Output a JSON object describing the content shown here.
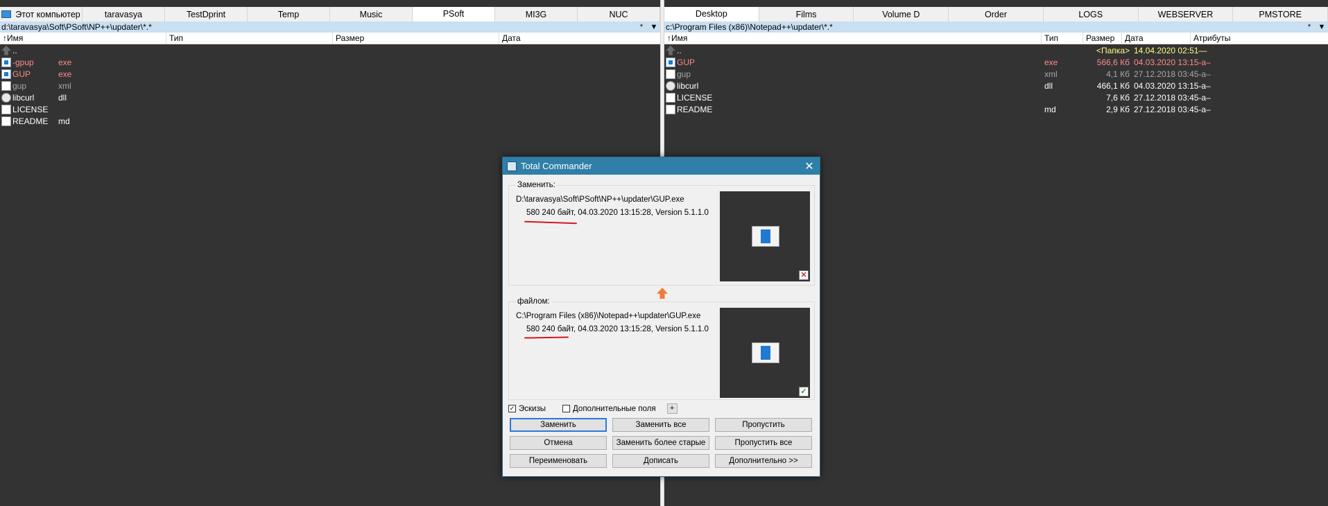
{
  "left_panel": {
    "tabs": [
      {
        "label": "Этот компьютер",
        "icon": "computer-icon"
      },
      {
        "label": "taravasya"
      },
      {
        "label": "TestDprint"
      },
      {
        "label": "Temp"
      },
      {
        "label": "Music"
      },
      {
        "label": "PSoft",
        "active": true
      },
      {
        "label": "MI3G"
      },
      {
        "label": "NUC"
      }
    ],
    "path": "d:\\taravasya\\Soft\\PSoft\\NP++\\updater\\*.*",
    "path_star": "*",
    "path_dropdown": "▼",
    "headers": {
      "name": "↑Имя",
      "type": "Тип",
      "size": "Размер",
      "date": "Дата"
    },
    "files": [
      {
        "name": "..",
        "ext": "",
        "icon": "up-icon",
        "color": "white"
      },
      {
        "name": "-gpup",
        "ext": "exe",
        "icon": "exe-icon",
        "color": "red"
      },
      {
        "name": "GUP",
        "ext": "exe",
        "icon": "exe-icon",
        "color": "red"
      },
      {
        "name": "gup",
        "ext": "xml",
        "icon": "xml-icon",
        "color": "gray"
      },
      {
        "name": "libcurl",
        "ext": "dll",
        "icon": "dll-icon",
        "color": "white"
      },
      {
        "name": "LICENSE",
        "ext": "",
        "icon": "file-icon",
        "color": "white"
      },
      {
        "name": "README",
        "ext": "md",
        "icon": "file-icon",
        "color": "white"
      }
    ]
  },
  "right_panel": {
    "tabs": [
      {
        "label": "Desktop",
        "active": true
      },
      {
        "label": "Films"
      },
      {
        "label": "Volume D"
      },
      {
        "label": "Order"
      },
      {
        "label": "LOGS"
      },
      {
        "label": "WEBSERVER"
      },
      {
        "label": "PMSTORE"
      }
    ],
    "path": "c:\\Program Files (x86)\\Notepad++\\updater\\*.*",
    "path_star": "*",
    "path_dropdown": "▼",
    "headers": {
      "name": "↑Имя",
      "type": "Тип",
      "size": "Размер",
      "date": "Дата",
      "attrs": "Атрибуты"
    },
    "files": [
      {
        "name": "..",
        "ext": "",
        "size": "<Папка>",
        "date": "14.04.2020 02:51—",
        "icon": "up-icon",
        "color": "yellow"
      },
      {
        "name": "GUP",
        "ext": "exe",
        "size": "566,6 Кб",
        "date": "04.03.2020 13:15-a–",
        "icon": "exe-icon",
        "color": "red"
      },
      {
        "name": "gup",
        "ext": "xml",
        "size": "4,1 Кб",
        "date": "27.12.2018 03:45-a–",
        "icon": "xml-icon",
        "color": "gray"
      },
      {
        "name": "libcurl",
        "ext": "dll",
        "size": "466,1 Кб",
        "date": "04.03.2020 13:15-a–",
        "icon": "dll-icon",
        "color": "white"
      },
      {
        "name": "LICENSE",
        "ext": "",
        "size": "7,6 Кб",
        "date": "27.12.2018 03:45-a–",
        "icon": "file-icon",
        "color": "white"
      },
      {
        "name": "README",
        "ext": "md",
        "size": "2,9 Кб",
        "date": "27.12.2018 03:45-a–",
        "icon": "file-icon",
        "color": "white"
      }
    ]
  },
  "dialog": {
    "title": "Total Commander",
    "close": "✕",
    "replace_label": "Заменить:",
    "replace_path": "D:\\taravasya\\Soft\\PSoft\\NP++\\updater\\GUP.exe",
    "replace_info": "580 240 байт, 04.03.2020 13:15:28, Version 5.1.1.0",
    "with_label": "файлом:",
    "with_path": "C:\\Program Files (x86)\\Notepad++\\updater\\GUP.exe",
    "with_info": "580 240 байт, 04.03.2020 13:15:28, Version 5.1.1.0",
    "thumbnails_label": "Эскизы",
    "thumbnails_checked": true,
    "extra_fields_label": "Дополнительные поля",
    "extra_fields_checked": false,
    "plus": "+",
    "buttons": {
      "replace": "Заменить",
      "replace_all": "Заменить все",
      "skip": "Пропустить",
      "cancel": "Отмена",
      "replace_older": "Заменить более старые",
      "skip_all": "Пропустить все",
      "rename": "Переименовать",
      "append": "Дописать",
      "more": "Дополнительно >>"
    }
  },
  "colors": {
    "panel_bg": "#333333",
    "accent": "#2f7fa8",
    "red_file": "#ff8a8a",
    "annotation": "#d41a1a"
  }
}
